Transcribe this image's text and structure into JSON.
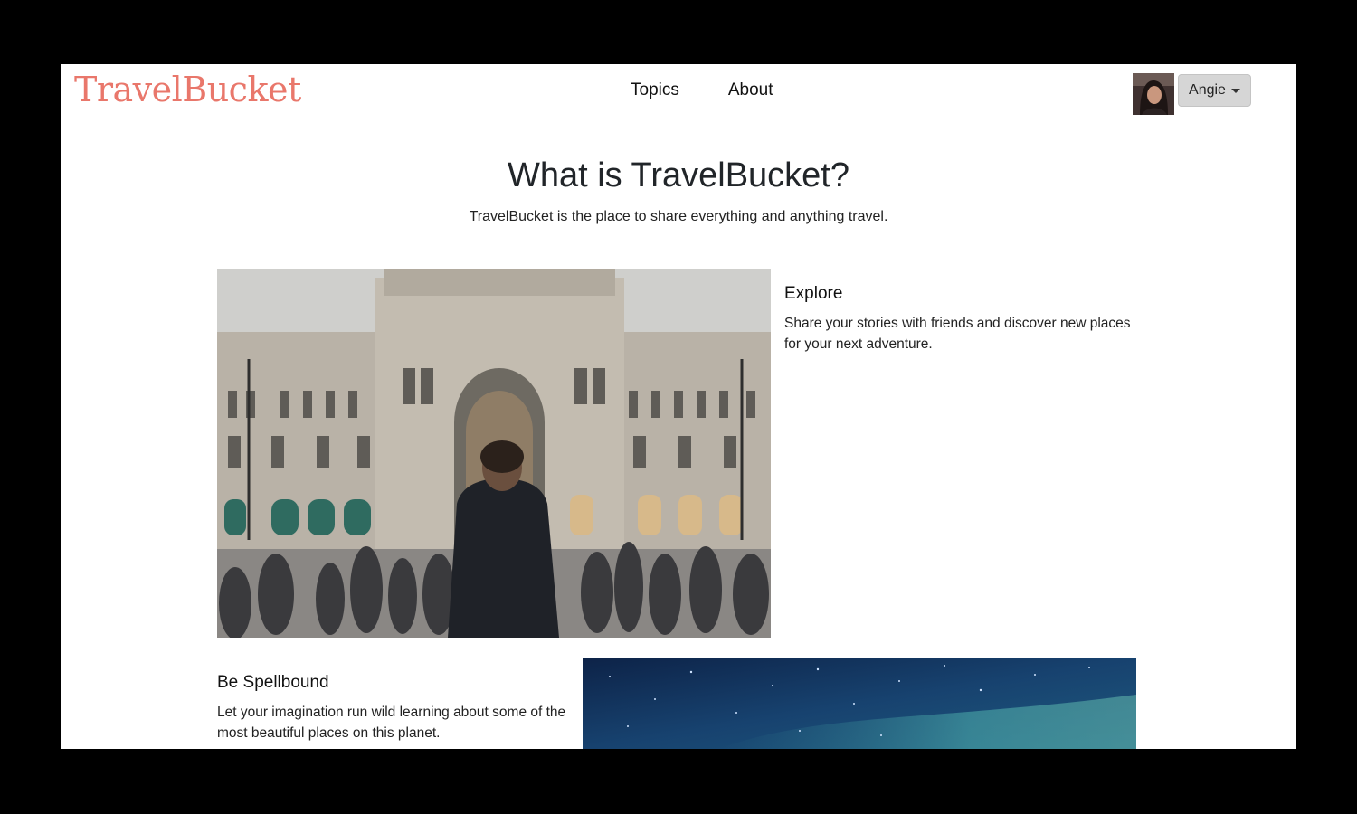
{
  "brand": "TravelBucket",
  "nav": {
    "topics": "Topics",
    "about": "About"
  },
  "user": {
    "name": "Angie"
  },
  "hero": {
    "title": "What is TravelBucket?",
    "subtitle": "TravelBucket is the place to share everything and anything travel."
  },
  "features": [
    {
      "title": "Explore",
      "text": "Share your stories with friends and discover new places for your next adventure."
    },
    {
      "title": "Be Spellbound",
      "text": "Let your imagination run wild learning about some of the most beautiful places on this planet."
    }
  ],
  "colors": {
    "brand": "#e9776b",
    "user_button": "#d6d6d6"
  },
  "icons": {
    "dropdown": "caret-down-icon"
  }
}
